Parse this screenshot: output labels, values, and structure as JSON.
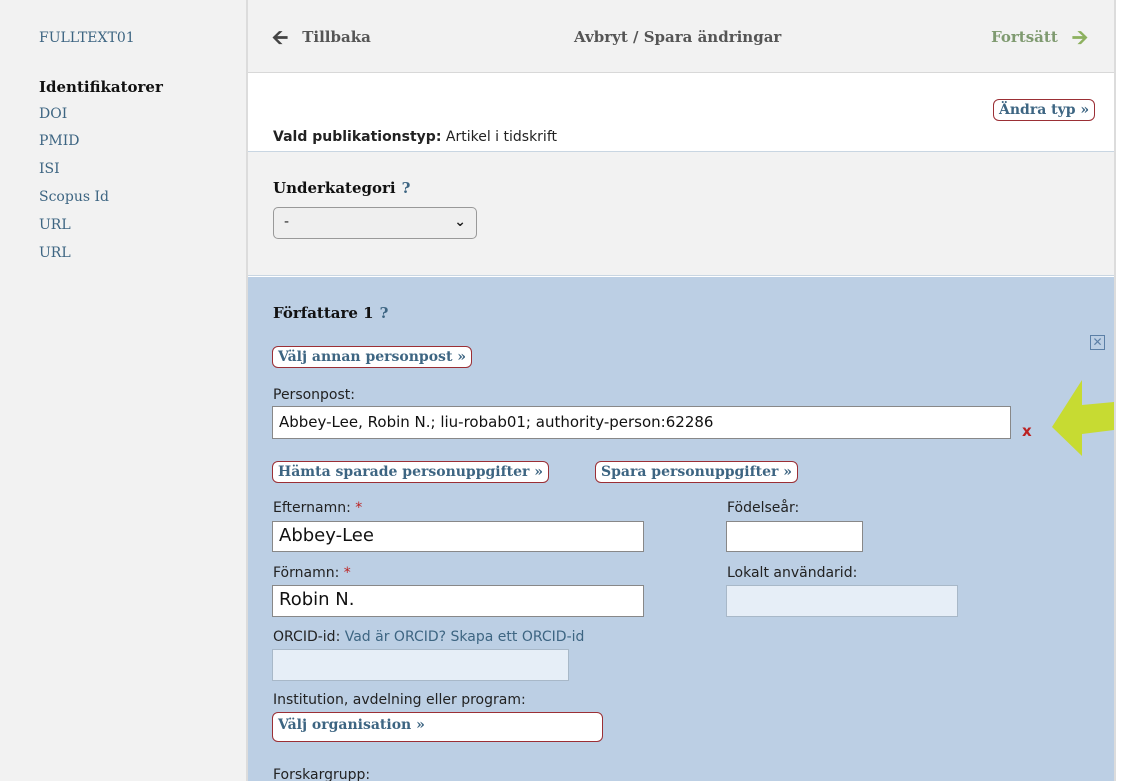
{
  "sidebar": {
    "top_item": "FULLTEXT01",
    "heading": "Identifikatorer",
    "items": [
      "DOI",
      "PMID",
      "ISI",
      "Scopus Id",
      "URL",
      "URL"
    ]
  },
  "topnav": {
    "back_label": "Tillbaka",
    "center_label": "Avbryt / Spara ändringar",
    "continue_label": "Fortsätt",
    "back_icon": "arrow-left-icon",
    "continue_icon": "arrow-right-icon"
  },
  "pubtype": {
    "label": "Vald publikationstyp:",
    "value": "Artikel i tidskrift",
    "change_button": "Ändra typ »"
  },
  "subcategory": {
    "title": "Underkategori",
    "help": "?",
    "selected": "-"
  },
  "author": {
    "title": "Författare 1",
    "help": "?",
    "choose_person_button": "Välj annan personpost »",
    "personpost_label": "Personpost:",
    "personpost_value": "Abbey-Lee, Robin N.; liu-robab01; authority-person:62286",
    "remove_mark": "x",
    "fetch_saved_button": "Hämta sparade personuppgifter »",
    "save_person_button": "Spara personuppgifter »",
    "lastname_label": "Efternamn:",
    "lastname_value": "Abbey-Lee",
    "birthyear_label": "Födelseår:",
    "birthyear_value": "",
    "firstname_label": "Förnamn:",
    "firstname_value": "Robin N.",
    "local_userid_label": "Lokalt användarid:",
    "local_userid_value": "",
    "orcid_label": "ORCID-id:",
    "orcid_what_link": "Vad är ORCID?",
    "orcid_create_link": "Skapa ett ORCID-id",
    "orcid_value": "",
    "required_mark": "*",
    "institution_label": "Institution, avdelning eller program:",
    "choose_org_button": "Välj organisation »",
    "research_group_label": "Forskargrupp:"
  },
  "colors": {
    "accent_link": "#3d6582",
    "button_border": "#9b2f35",
    "author_bg": "#bccfe4",
    "annotation_arrow": "#c8dc1e"
  }
}
